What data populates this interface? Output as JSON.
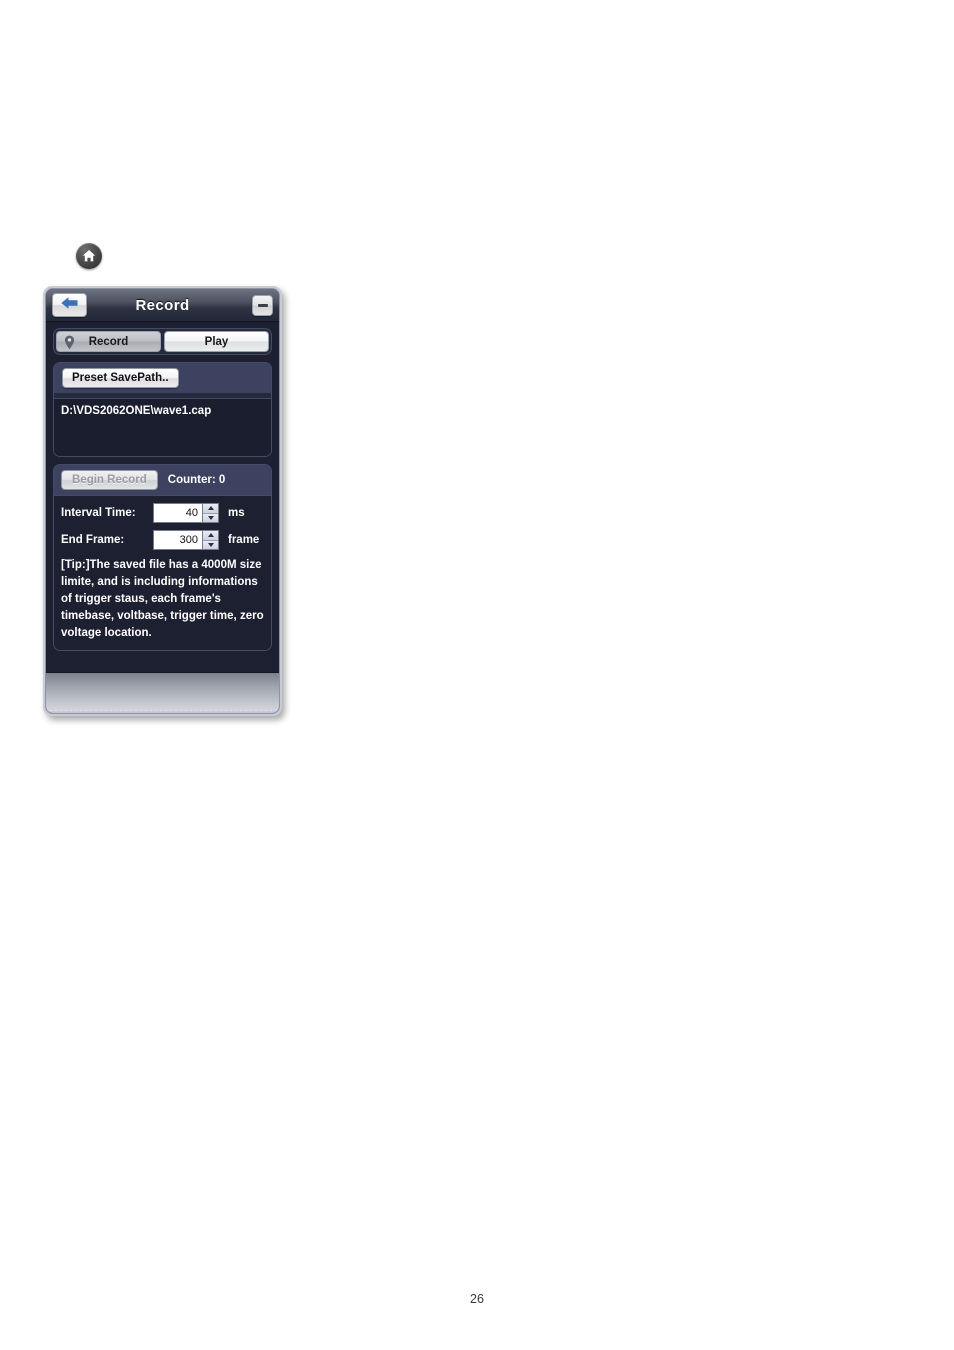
{
  "home_button": {
    "icon": "home-icon"
  },
  "panel": {
    "titlebar": {
      "back_icon": "back-arrow-icon",
      "title": "Record",
      "minimize_icon": "minimize-icon"
    },
    "tabs": [
      {
        "label": "Record",
        "icon": "pin-icon",
        "active": true
      },
      {
        "label": "Play",
        "icon": "",
        "active": false
      }
    ],
    "savepath": {
      "button_label": "Preset SavePath..",
      "path_value": "D:\\VDS2062ONE\\wave1.cap"
    },
    "record": {
      "begin_label": "Begin Record",
      "counter_label": "Counter:  0",
      "interval": {
        "label": "Interval Time:",
        "value": "40",
        "unit": "ms",
        "up_icon": "spinner-up-icon",
        "down_icon": "spinner-down-icon"
      },
      "end_frame": {
        "label": "End Frame:",
        "value": "300",
        "unit": "frame",
        "up_icon": "spinner-up-icon",
        "down_icon": "spinner-down-icon"
      },
      "tip": "[Tip:]The saved file has a 4000M size limite, and is including informations of trigger staus, each frame's timebase, voltbase, trigger time, zero voltage location."
    }
  },
  "page": {
    "number": "26"
  },
  "colors": {
    "panel_background": "#1d2030",
    "group_background": "#262a3d",
    "group_header": "#3c4260",
    "accent_blue": "#3d6fb5",
    "text_white": "#ffffff",
    "disabled_text": "#9a9ba2"
  }
}
